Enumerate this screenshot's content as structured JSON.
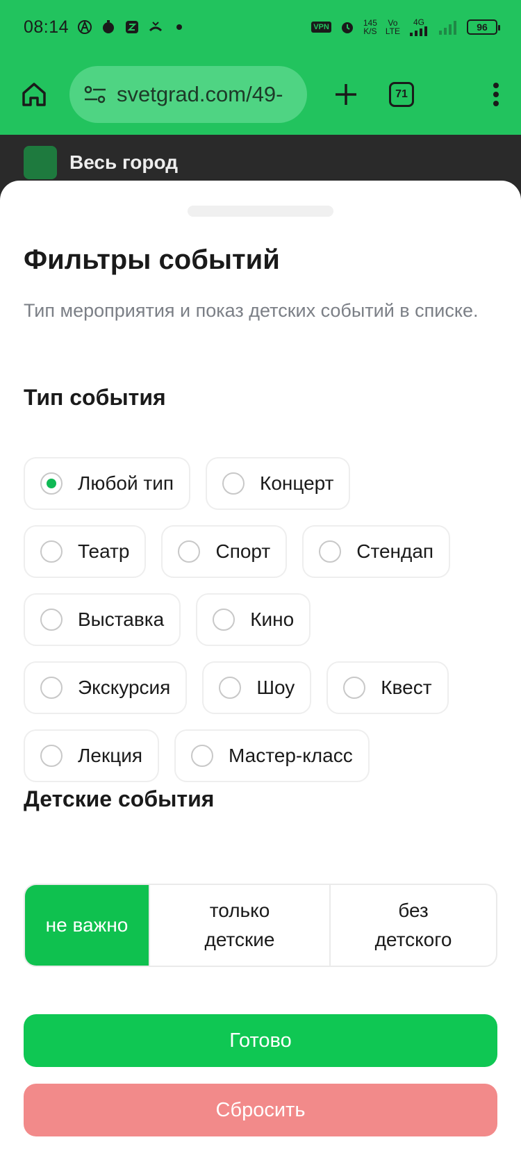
{
  "status_bar": {
    "time": "08:14",
    "vpn": "VPN",
    "speed_value": "145",
    "speed_unit": "K/S",
    "volte_top": "Vo",
    "volte_bottom": "LTE",
    "network": "4G",
    "battery": "96"
  },
  "browser": {
    "url": "svetgrad.com/49-",
    "tab_count": "71"
  },
  "page_behind": {
    "site_name": "Весь город"
  },
  "sheet": {
    "title": "Фильтры событий",
    "subtitle": "Тип мероприятия и показ детских событий в списке.",
    "event_type_title": "Тип события",
    "event_types": [
      {
        "label": "Любой тип",
        "checked": true
      },
      {
        "label": "Концерт",
        "checked": false
      },
      {
        "label": "Театр",
        "checked": false
      },
      {
        "label": "Спорт",
        "checked": false
      },
      {
        "label": "Стендап",
        "checked": false
      },
      {
        "label": "Выставка",
        "checked": false
      },
      {
        "label": "Кино",
        "checked": false
      },
      {
        "label": "Экскурсия",
        "checked": false
      },
      {
        "label": "Шоу",
        "checked": false
      },
      {
        "label": "Квест",
        "checked": false
      },
      {
        "label": "Лекция",
        "checked": false
      },
      {
        "label": "Мастер-класс",
        "checked": false
      }
    ],
    "kids_title": "Детские события",
    "kids_options": [
      {
        "label": "не важно",
        "active": true
      },
      {
        "label": "только детские",
        "active": false
      },
      {
        "label": "без детского",
        "active": false
      }
    ],
    "done_label": "Готово",
    "reset_label": "Сбросить"
  },
  "colors": {
    "brand_green": "#22c35e",
    "accent_green": "#0fc14f",
    "reset_red": "#f28a8a"
  }
}
